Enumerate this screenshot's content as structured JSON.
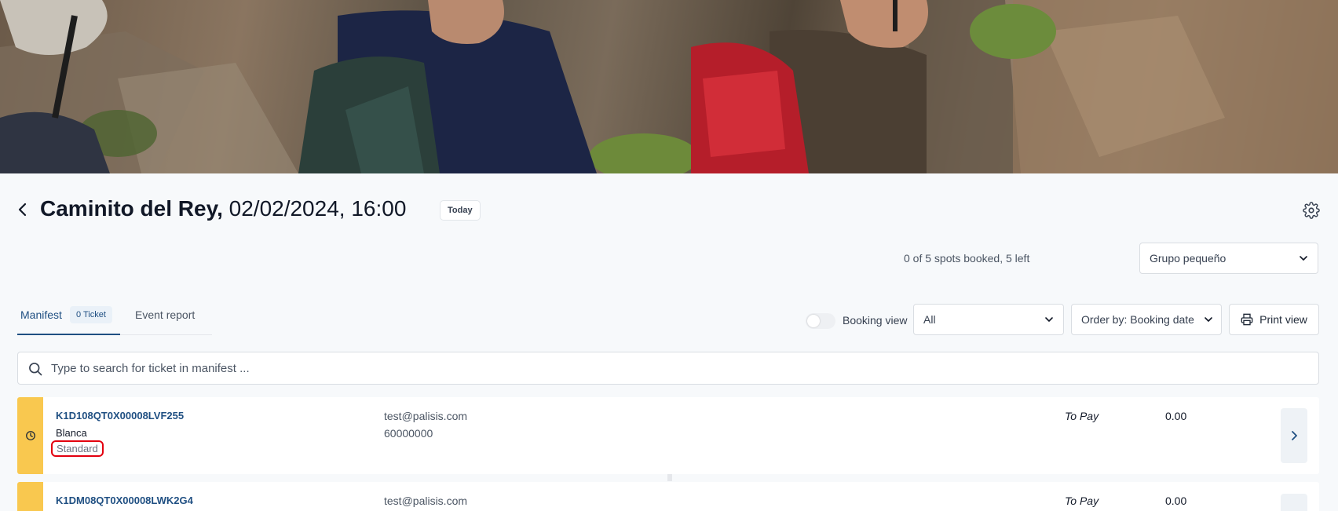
{
  "colors": {
    "accent": "#1f4f82",
    "ticket_pending_bar": "#f9c84f",
    "highlight_outline": "#e3000f"
  },
  "hero": {
    "icon": "hikers-photo"
  },
  "header": {
    "back_icon": "chevron-left-icon",
    "event_name": "Caminito del Rey,",
    "event_datetime": "02/02/2024, 16:00",
    "today_badge": "Today",
    "settings_icon": "gear-icon"
  },
  "availability": {
    "spots_text": "0 of 5 spots booked, 5 left",
    "group_select": "Grupo pequeño"
  },
  "tabs": [
    {
      "label": "Manifest",
      "badge": "0 Ticket",
      "active": true
    },
    {
      "label": "Event report",
      "active": false
    }
  ],
  "controls": {
    "booking_view_label": "Booking view",
    "booking_view_on": false,
    "filter_select": "All",
    "order_select": "Order by: Booking date",
    "print_label": "Print view",
    "print_icon": "printer-icon"
  },
  "search": {
    "placeholder": "Type to search for ticket in manifest ...",
    "value": "",
    "icon": "search-icon"
  },
  "tickets": [
    {
      "id": "K1D108QT0X00008LVF255",
      "name": "Blanca",
      "type": "Standard",
      "email": "test@palisis.com",
      "phone": "60000000",
      "status": "To Pay",
      "amount": "0.00",
      "status_icon": "clock-icon",
      "open_icon": "chevron-right-icon"
    },
    {
      "id": "K1DM08QT0X00008LWK2G4",
      "name": "",
      "type": "",
      "email": "test@palisis.com",
      "phone": "",
      "status": "To Pay",
      "amount": "0.00",
      "status_icon": "clock-icon",
      "open_icon": "chevron-right-icon"
    }
  ]
}
